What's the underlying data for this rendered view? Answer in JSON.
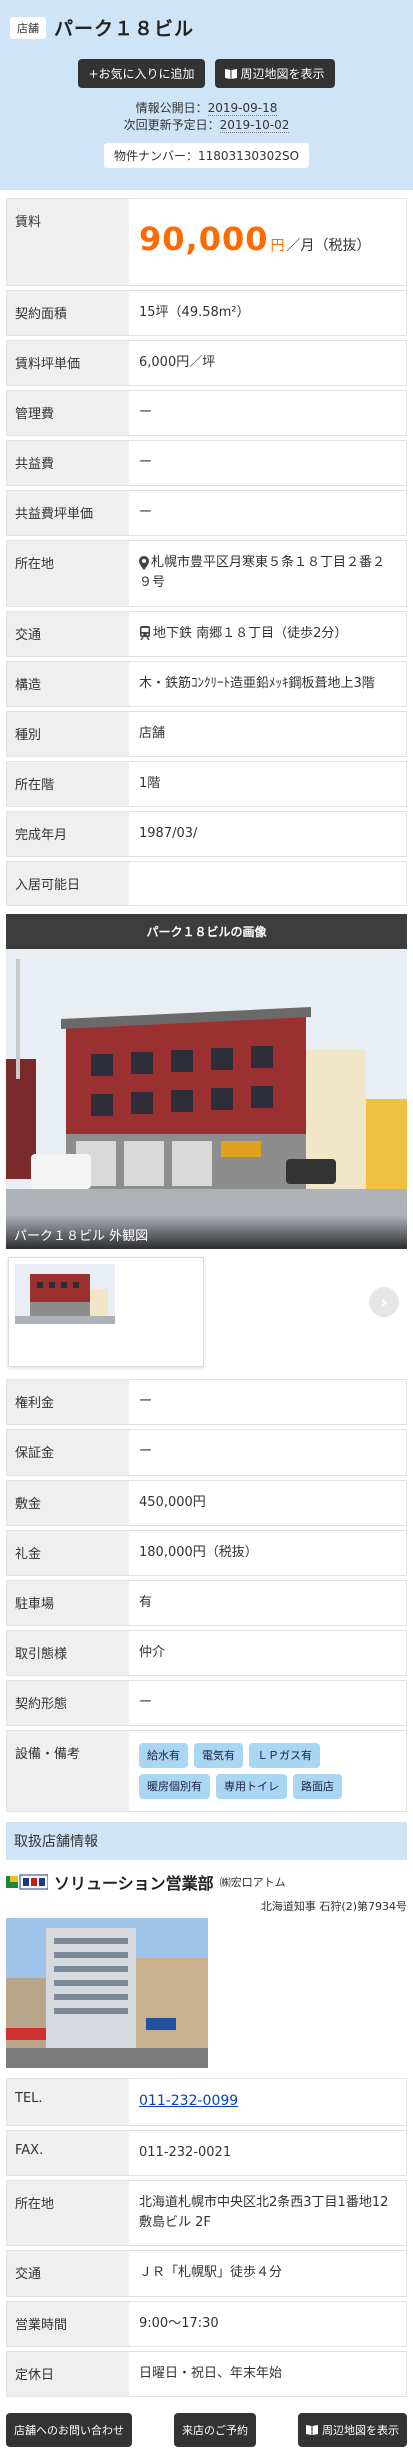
{
  "header": {
    "type_badge": "店舗",
    "title": "パーク１８ビル",
    "favorite_button": "+お気に入りに追加",
    "map_button": "周辺地図を表示",
    "published_label": "情報公開日：",
    "published_date": "2019-09-18",
    "next_update_label": "次回更新予定日：",
    "next_update_date": "2019-10-02",
    "property_number": "物件ナンバー：11803130302SO"
  },
  "rent": {
    "label": "賃料",
    "price": "90,000",
    "unit": "円",
    "suffix": "／月（税抜）"
  },
  "specs": [
    {
      "key": "契約面積",
      "value": "15坪（49.58m²）"
    },
    {
      "key": "賃料坪単価",
      "value": "6,000円／坪"
    },
    {
      "key": "管理費",
      "value": "ー"
    },
    {
      "key": "共益費",
      "value": "ー"
    },
    {
      "key": "共益費坪単価",
      "value": "ー"
    },
    {
      "key": "所在地",
      "value": "札幌市豊平区月寒東５条１８丁目２番２９号"
    },
    {
      "key": "交通",
      "value": "地下鉄 南郷１８丁目（徒歩2分）"
    },
    {
      "key": "構造",
      "value": "木・鉄筋ｺﾝｸﾘｰﾄ造亜鉛ﾒｯｷ鋼板葺地上3階"
    },
    {
      "key": "種別",
      "value": "店舗"
    },
    {
      "key": "所在階",
      "value": "1階"
    },
    {
      "key": "完成年月",
      "value": "1987/03/"
    },
    {
      "key": "入居可能日",
      "value": ""
    }
  ],
  "gallery": {
    "heading": "パーク１８ビルの画像",
    "caption": "パーク１８ビル 外観図",
    "next_glyph": "›"
  },
  "specs2": [
    {
      "key": "権利金",
      "value": "ー"
    },
    {
      "key": "保証金",
      "value": "ー"
    },
    {
      "key": "敷金",
      "value": "450,000円"
    },
    {
      "key": "礼金",
      "value": "180,000円（税抜）"
    },
    {
      "key": "駐車場",
      "value": "有"
    },
    {
      "key": "取引態様",
      "value": "仲介"
    },
    {
      "key": "契約形態",
      "value": "ー"
    }
  ],
  "equipment": {
    "label": "設備・備考",
    "tags": [
      "給水有",
      "電気有",
      "ＬＰガス有",
      "暖房個別有",
      "専用トイレ",
      "路面店"
    ]
  },
  "shop": {
    "heading": "取扱店舗情報",
    "name": "ソリューション営業部",
    "corp": "㈱宏口アトム",
    "license": "北海道知事 石狩(2)第7934号",
    "rows": [
      {
        "key": "TEL.",
        "value": "011-232-0099"
      },
      {
        "key": "FAX.",
        "value": "011-232-0021"
      },
      {
        "key": "所在地",
        "value": "北海道札幌市中央区北2条西3丁目1番地12 敷島ビル 2F"
      },
      {
        "key": "交通",
        "value": "ＪＲ「札幌駅」徒歩４分"
      },
      {
        "key": "営業時間",
        "value": "9:00〜17:30"
      },
      {
        "key": "定休日",
        "value": "日曜日・祝日、年末年始"
      }
    ]
  },
  "footer": {
    "contact_button": "店舗へのお問い合わせ",
    "visit_button": "来店のご予約",
    "map_button": "周辺地図を表示"
  },
  "colors": {
    "header_bg": "#cfe4f6",
    "price": "#ff6a00",
    "tag_bg": "#a8d6f3",
    "dark_button": "#333333"
  }
}
